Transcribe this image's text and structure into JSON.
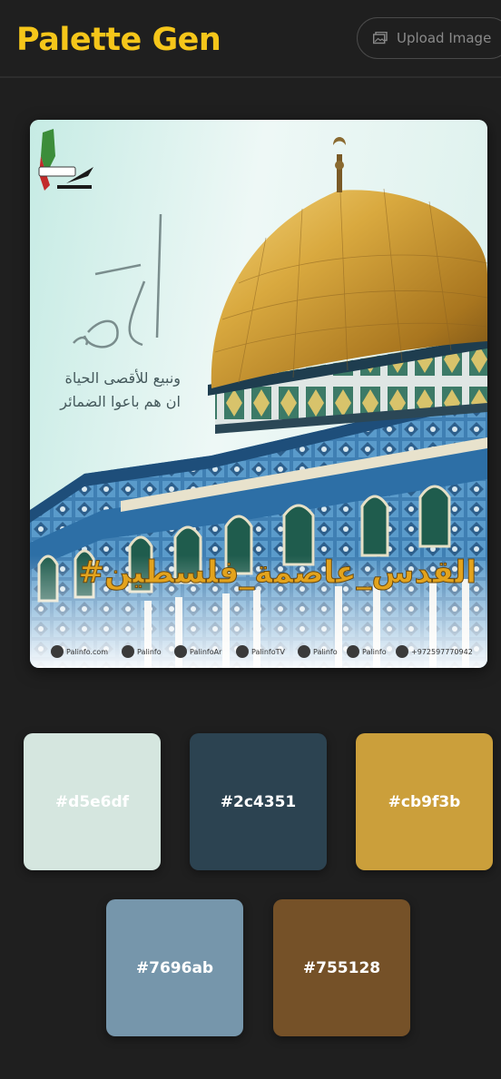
{
  "header": {
    "title": "Palette Gen",
    "upload_label": "Upload Image",
    "title_color": "#f5c61a"
  },
  "preview": {
    "arabic_line1": "ونبيع للأقصى الحياة",
    "arabic_line2": "ان هم باعوا الضمائر",
    "hashtag": "#القدس_عاصمة_فلسطين",
    "footer": [
      "Palinfo.com",
      "Palinfo",
      "PalinfoAr",
      "PalinfoTV",
      "Palinfo",
      "Palinfo",
      "+972597770942"
    ]
  },
  "palette": [
    {
      "hex": "#d5e6df",
      "label": "#d5e6df"
    },
    {
      "hex": "#2c4351",
      "label": "#2c4351"
    },
    {
      "hex": "#cb9f3b",
      "label": "#cb9f3b"
    },
    {
      "hex": "#7696ab",
      "label": "#7696ab"
    },
    {
      "hex": "#755128",
      "label": "#755128"
    }
  ]
}
